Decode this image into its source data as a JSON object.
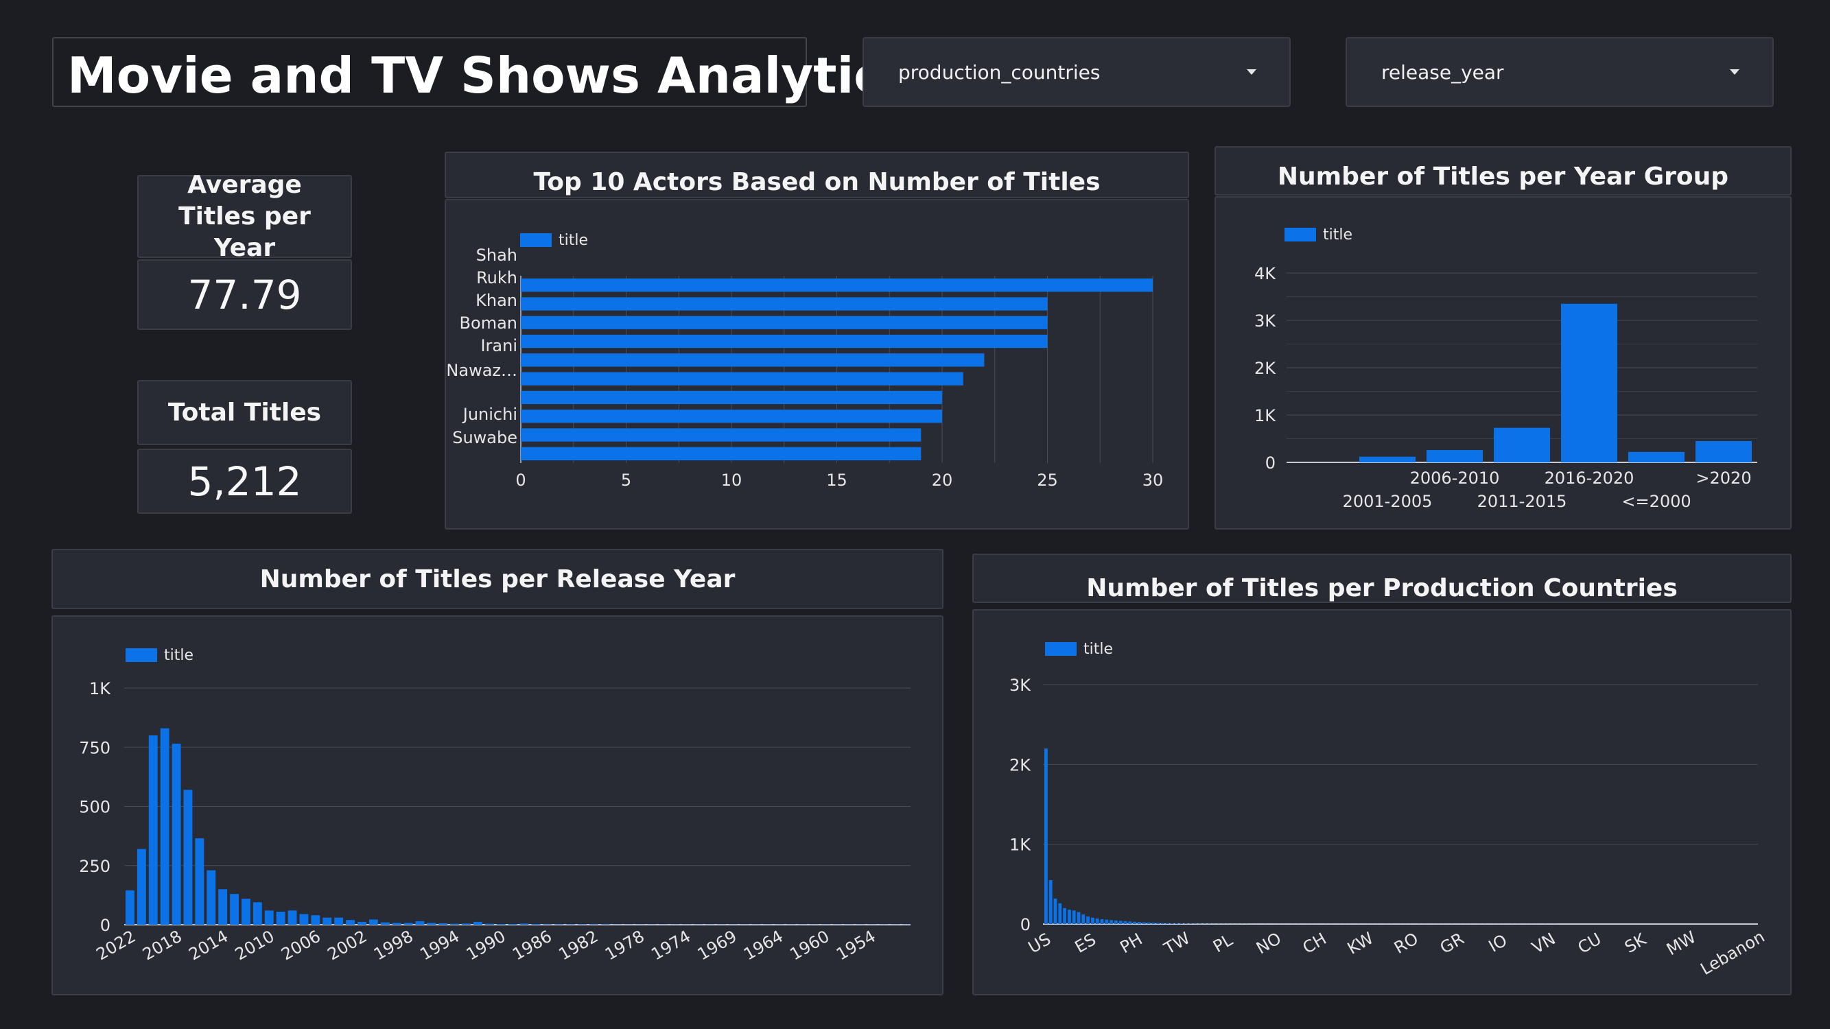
{
  "header": {
    "title": "Movie and TV Shows Analytics",
    "filters": [
      {
        "label": "production_countries"
      },
      {
        "label": "release_year"
      }
    ]
  },
  "kpis": {
    "avg_titles": {
      "label": "Average Titles per Year",
      "value": "77.79"
    },
    "total_titles": {
      "label": "Total Titles",
      "value": "5,212"
    }
  },
  "colors": {
    "bar": "#0b72e7",
    "grid": "#4a4d55",
    "panel": "#282b33",
    "background": "#1c1d22"
  },
  "chart_data": [
    {
      "id": "actors",
      "type": "bar",
      "orientation": "horizontal",
      "title": "Top 10 Actors Based on Number of Titles",
      "legend": "title",
      "legend_position": "top-left",
      "y_tick_labels": [
        "Shah",
        "Rukh",
        "Khan",
        "Boman",
        "Irani",
        "Nawaz…",
        "Junichi",
        "Suwabe"
      ],
      "values": [
        30,
        25,
        25,
        25,
        22,
        21,
        20,
        20,
        19,
        19
      ],
      "x_ticks": [
        "0",
        "5",
        "10",
        "15",
        "20",
        "25",
        "30"
      ],
      "xlim": [
        0,
        30
      ],
      "grid": true
    },
    {
      "id": "year_group",
      "type": "bar",
      "title": "Number of Titles per Year Group",
      "legend": "title",
      "legend_position": "top-left",
      "categories": [
        "",
        "2001-2005",
        "2006-2010",
        "2011-2015",
        "2016-2020",
        "<=2000",
        ">2020"
      ],
      "values": [
        0,
        120,
        260,
        730,
        3350,
        220,
        450
      ],
      "y_ticks": [
        "0",
        "1K",
        "2K",
        "3K",
        "4K"
      ],
      "ylim": [
        0,
        4000
      ],
      "grid": true
    },
    {
      "id": "release_year",
      "type": "bar",
      "title": "Number of Titles per Release Year",
      "legend": "title",
      "legend_position": "top-left",
      "x_tick_labels": [
        "2022",
        "2018",
        "2014",
        "2010",
        "2006",
        "2002",
        "1998",
        "1994",
        "1990",
        "1986",
        "1982",
        "1978",
        "1974",
        "1969",
        "1964",
        "1960",
        "1954"
      ],
      "values": [
        145,
        320,
        800,
        830,
        765,
        570,
        365,
        230,
        150,
        130,
        110,
        95,
        60,
        55,
        60,
        45,
        40,
        30,
        30,
        20,
        12,
        22,
        10,
        8,
        8,
        15,
        8,
        6,
        4,
        5,
        12,
        4,
        3,
        3,
        5,
        3,
        2,
        2,
        2,
        2,
        2,
        2,
        1,
        1,
        1,
        1,
        1,
        1,
        1,
        1,
        1,
        1,
        1,
        1,
        1,
        1,
        1,
        1,
        1,
        1,
        1,
        1,
        1,
        1,
        1,
        1,
        1,
        1
      ],
      "y_ticks": [
        "0",
        "250",
        "500",
        "750",
        "1K"
      ],
      "ylim": [
        0,
        1000
      ],
      "grid": true
    },
    {
      "id": "countries",
      "type": "bar",
      "title": "Number of Titles per Production Countries",
      "legend": "title",
      "legend_position": "top-left",
      "x_tick_labels": [
        "US",
        "ES",
        "PH",
        "TW",
        "PL",
        "NO",
        "CH",
        "KW",
        "RO",
        "GR",
        "IO",
        "VN",
        "CU",
        "SK",
        "MW",
        "Lebanon"
      ],
      "values": [
        2200,
        550,
        320,
        260,
        200,
        180,
        170,
        150,
        120,
        95,
        80,
        70,
        60,
        55,
        50,
        45,
        40,
        36,
        32,
        28,
        25,
        22,
        20,
        18,
        16,
        14,
        12,
        10,
        9,
        8,
        7,
        6,
        5,
        5,
        4,
        4,
        3,
        3,
        3,
        2,
        2,
        2,
        2,
        2,
        1,
        1,
        1,
        1,
        1,
        1,
        1,
        1,
        1,
        1,
        1,
        1,
        1,
        1,
        1,
        1,
        1,
        1,
        1,
        1,
        1,
        1,
        1,
        1,
        1,
        1,
        1,
        1,
        1,
        1,
        1,
        1,
        1,
        1,
        1,
        1,
        1,
        1,
        1,
        1,
        1,
        1,
        1,
        1,
        1,
        1,
        1,
        1,
        1,
        1,
        1,
        1,
        1,
        1,
        1,
        1,
        1,
        1,
        1,
        1,
        1,
        1,
        1,
        1,
        1,
        1
      ],
      "y_ticks": [
        "0",
        "1K",
        "2K",
        "3K"
      ],
      "ylim": [
        0,
        3000
      ],
      "grid": true
    }
  ]
}
